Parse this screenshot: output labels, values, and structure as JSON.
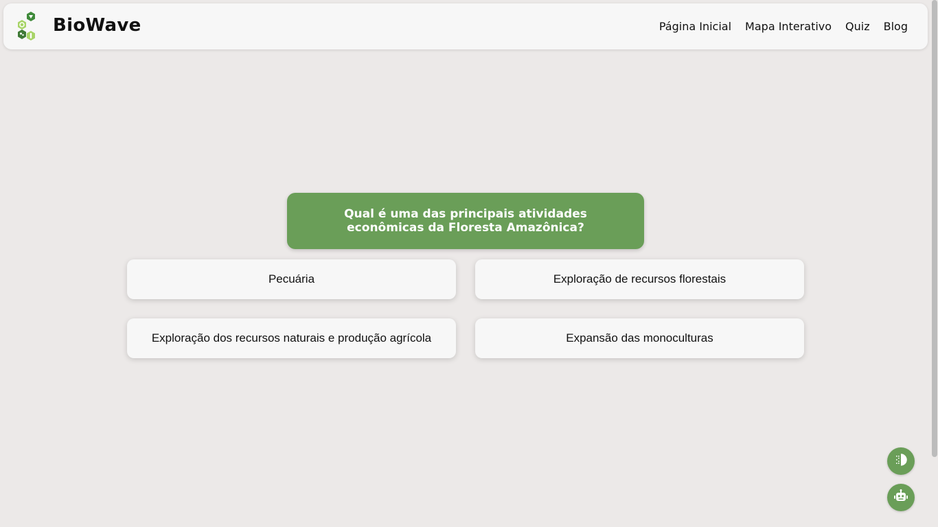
{
  "header": {
    "brand": "BioWave",
    "nav": [
      {
        "label": "Página Inicial"
      },
      {
        "label": "Mapa Interativo"
      },
      {
        "label": "Quiz"
      },
      {
        "label": "Blog"
      }
    ]
  },
  "quiz": {
    "question": "Qual é uma das principais atividades econômicas da Floresta Amazônica?",
    "answers": [
      {
        "label": "Pecuária"
      },
      {
        "label": "Exploração de recursos florestais"
      },
      {
        "label": "Exploração dos recursos naturais e produção agrícola"
      },
      {
        "label": "Expansão das monoculturas"
      }
    ]
  },
  "icons": {
    "logo": "leaf-hexagons-icon",
    "contrast": "contrast-toggle-icon",
    "chatbot": "robot-icon"
  },
  "colors": {
    "accent": "#6a9e58",
    "background": "#ece9e8",
    "card": "#f7f7f7"
  }
}
